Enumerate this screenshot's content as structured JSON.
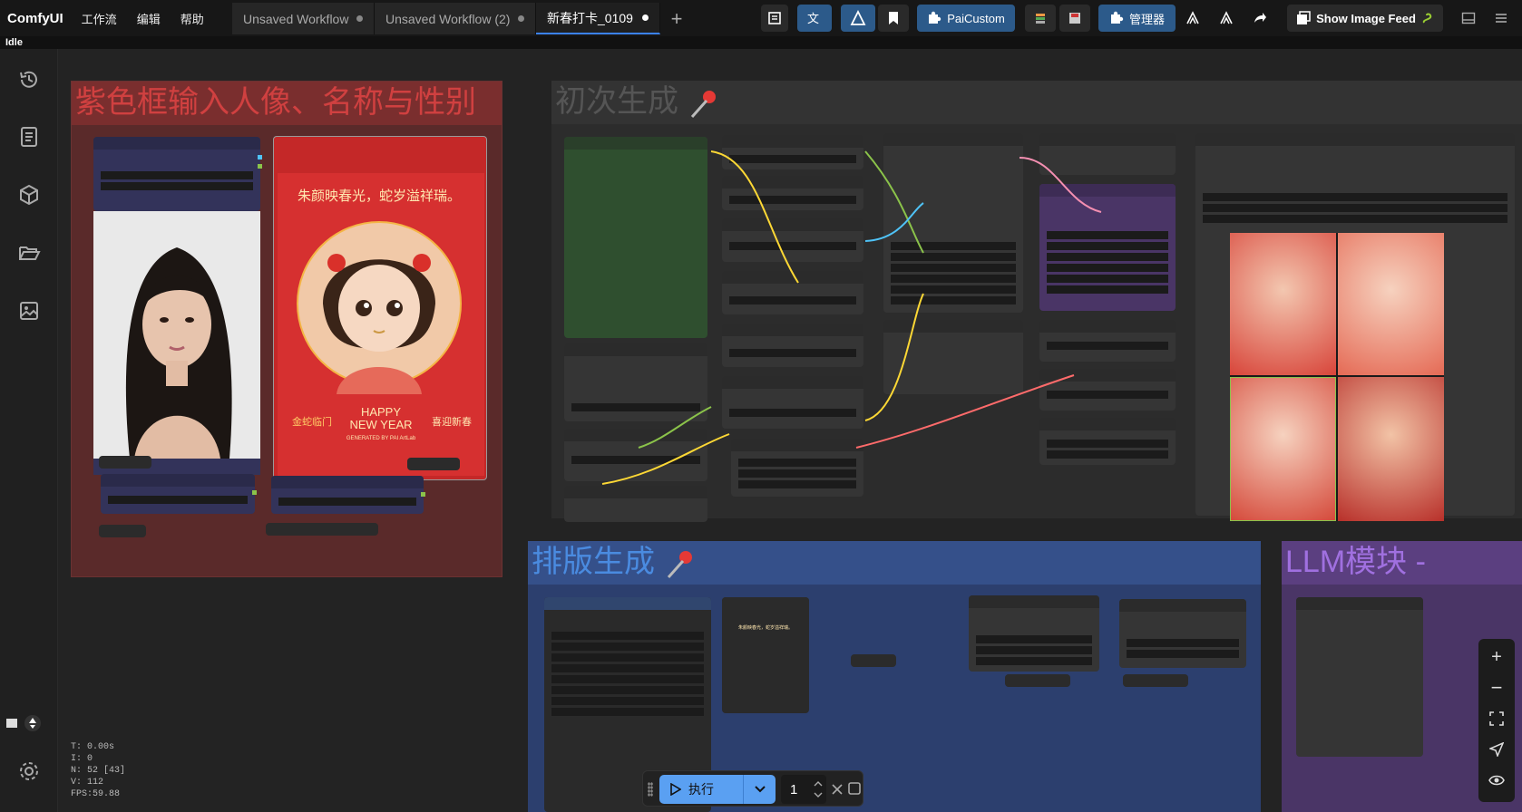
{
  "app": {
    "name": "ComfyUI",
    "status": "Idle"
  },
  "menu": [
    "工作流",
    "编辑",
    "帮助"
  ],
  "tabs": [
    {
      "label": "Unsaved Workflow"
    },
    {
      "label": "Unsaved Workflow (2)"
    },
    {
      "label": "新春打卡_0109",
      "active": true
    }
  ],
  "toolbar": {
    "pai_custom": "PaiCustom",
    "manager": "管理器",
    "image_feed": "Show Image Feed"
  },
  "groups": {
    "portrait": "紫色框输入人像、名称与性别",
    "first_gen": "初次生成",
    "layout_gen": "排版生成",
    "llm": "LLM模块 -"
  },
  "poster": {
    "greeting": "朱颜映春光，蛇岁溢祥瑞。",
    "left_text": "金蛇临门",
    "right_text": "喜迎新春",
    "happy": "HAPPY",
    "new_year": "NEW YEAR",
    "credit": "GENERATED BY PAI ArtLab"
  },
  "layout_preview_text": "朱颜映春光，蛇岁溢祥瑞。",
  "stats": {
    "t": "T: 0.00s",
    "i": "I: 0",
    "n": "N: 52 [43]",
    "v": "V: 112",
    "fps": "FPS:59.88"
  },
  "run": {
    "label": "执行",
    "count": "1"
  },
  "colors": {
    "accent": "#3b82f6",
    "red_group": "#5a2a2a",
    "blue_group": "#2c3f6e",
    "purple_group": "#4a3566"
  }
}
